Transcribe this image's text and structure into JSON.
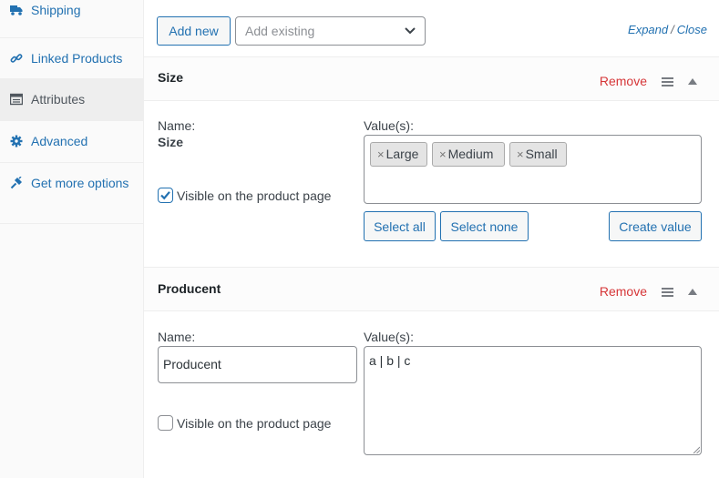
{
  "sidebar": {
    "items": [
      {
        "label": "Shipping",
        "icon": "truck-icon"
      },
      {
        "label": "Linked Products",
        "icon": "link-icon"
      },
      {
        "label": "Attributes",
        "icon": "table-icon",
        "active": true
      },
      {
        "label": "Advanced",
        "icon": "gear-icon"
      },
      {
        "label": "Get more options",
        "icon": "plugin-icon"
      }
    ]
  },
  "toolbar": {
    "add_new_label": "Add new",
    "add_existing_placeholder": "Add existing",
    "expand_label": "Expand",
    "separator": "/",
    "close_label": "Close"
  },
  "attributes": [
    {
      "title": "Size",
      "remove_label": "Remove",
      "name_label": "Name:",
      "name_value": "Size",
      "values_label": "Value(s):",
      "chips": [
        "Large",
        "Medium",
        "Small"
      ],
      "chip_remove_glyph": "×",
      "visible_label": "Visible on the product page",
      "visible_checked": true,
      "select_all_label": "Select all",
      "select_none_label": "Select none",
      "create_value_label": "Create value"
    },
    {
      "title": "Producent",
      "remove_label": "Remove",
      "name_label": "Name:",
      "name_value": "Producent",
      "values_label": "Value(s):",
      "values_text": "a | b | c",
      "visible_label": "Visible on the product page",
      "visible_checked": false
    }
  ],
  "colors": {
    "link": "#2271b1",
    "remove": "#d63638",
    "text": "#3c434a",
    "border": "#8c8f94"
  }
}
